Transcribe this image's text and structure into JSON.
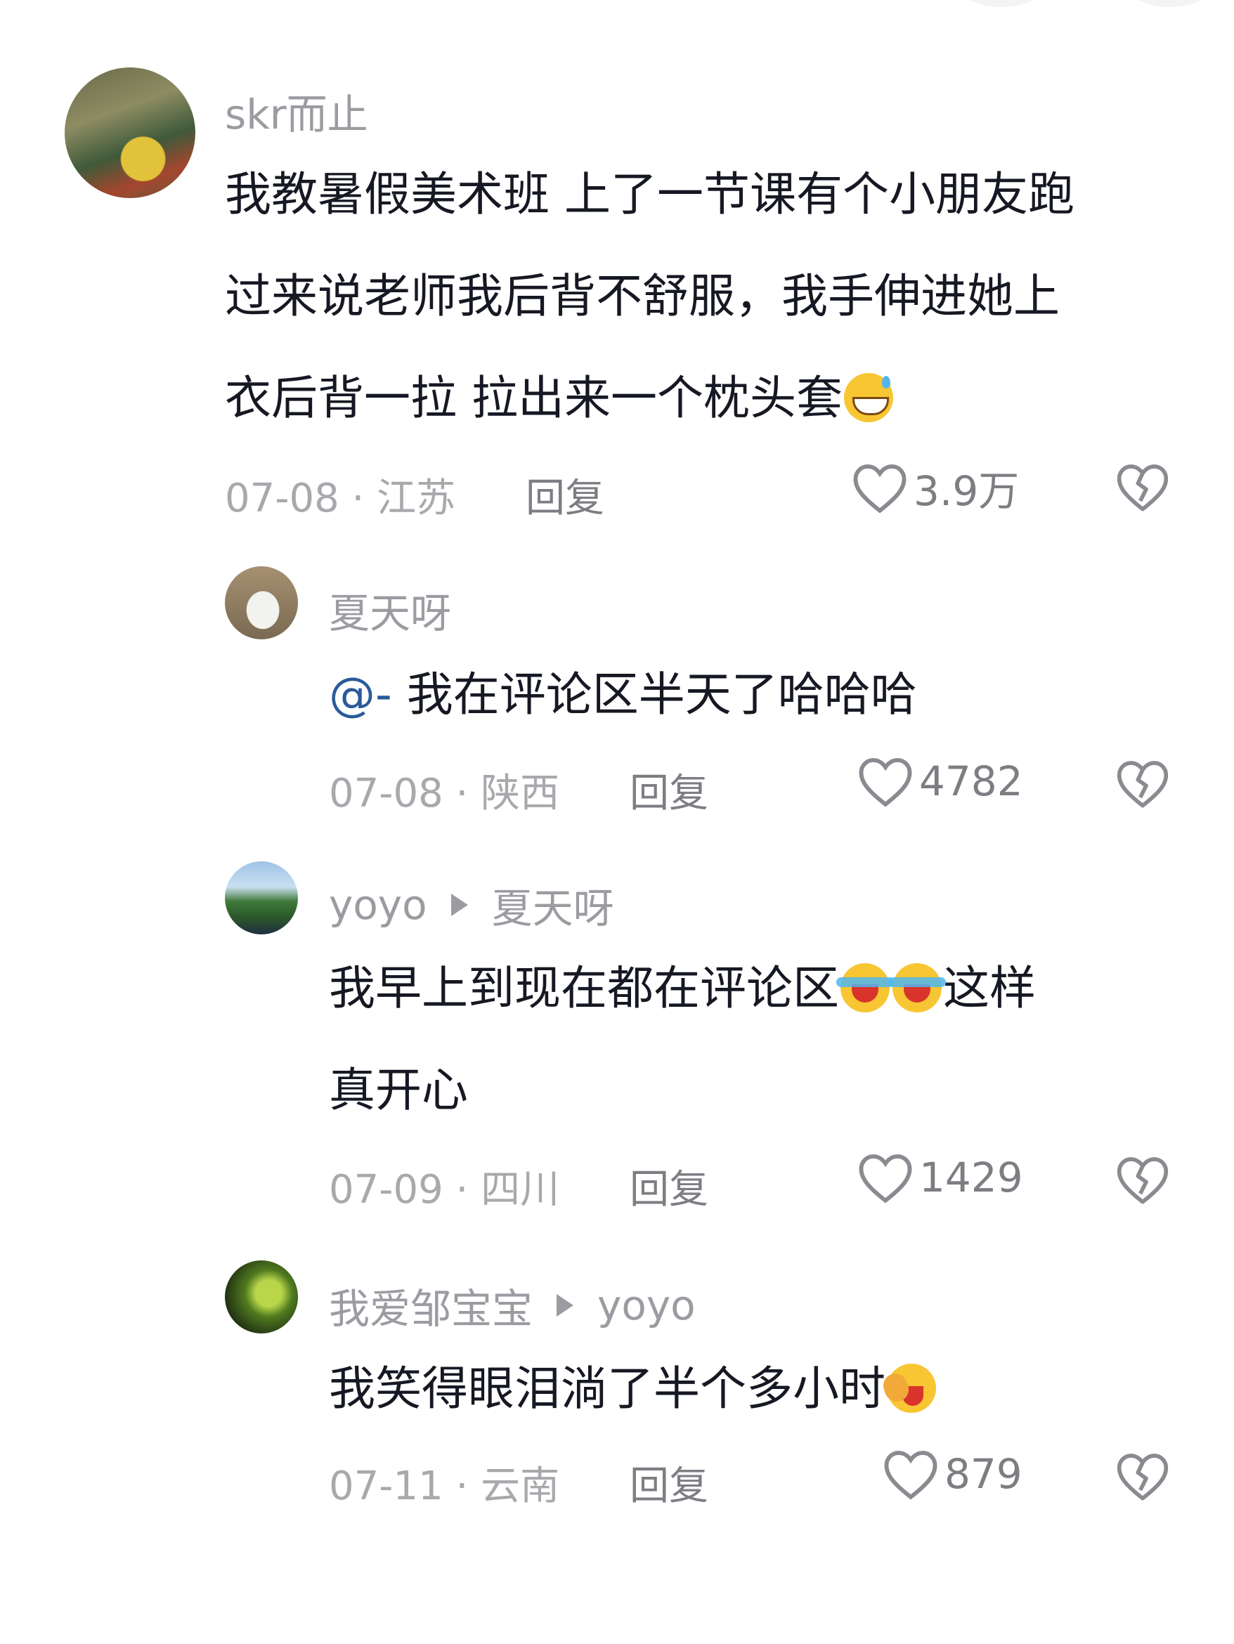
{
  "comments": [
    {
      "author": "skr而止",
      "lines": [
        "我教暑假美术班 上了一节课有个小朋友跑",
        "过来说老师我后背不舒服，我手伸进她上",
        "衣后背一拉 拉出来一个枕头套"
      ],
      "emoji_end": "grinning-sweat-emoji",
      "date": "07-08 · 江苏",
      "reply_label": "回复",
      "likes": "3.9万"
    },
    {
      "author": "夏天呀",
      "mention": "@-",
      "text": " 我在评论区半天了哈哈哈",
      "date": "07-08 · 陕西",
      "reply_label": "回复",
      "likes": "4782"
    },
    {
      "author": "yoyo",
      "reply_to": "夏天呀",
      "line1_a": "我早上到现在都在评论区",
      "line1_b": "这样",
      "line2": "真开心",
      "date": "07-09 · 四川",
      "reply_label": "回复",
      "likes": "1429"
    },
    {
      "author": "我爱邹宝宝",
      "reply_to": "yoyo",
      "text": "我笑得眼泪淌了半个多小时",
      "date": "07-11 · 云南",
      "reply_label": "回复",
      "likes": "879"
    }
  ],
  "icons": {
    "like": "heart-outline-icon",
    "dislike": "broken-heart-icon"
  },
  "colors": {
    "text": "#161823",
    "meta": "#a8a9ad",
    "mention": "#2a5a9a"
  }
}
